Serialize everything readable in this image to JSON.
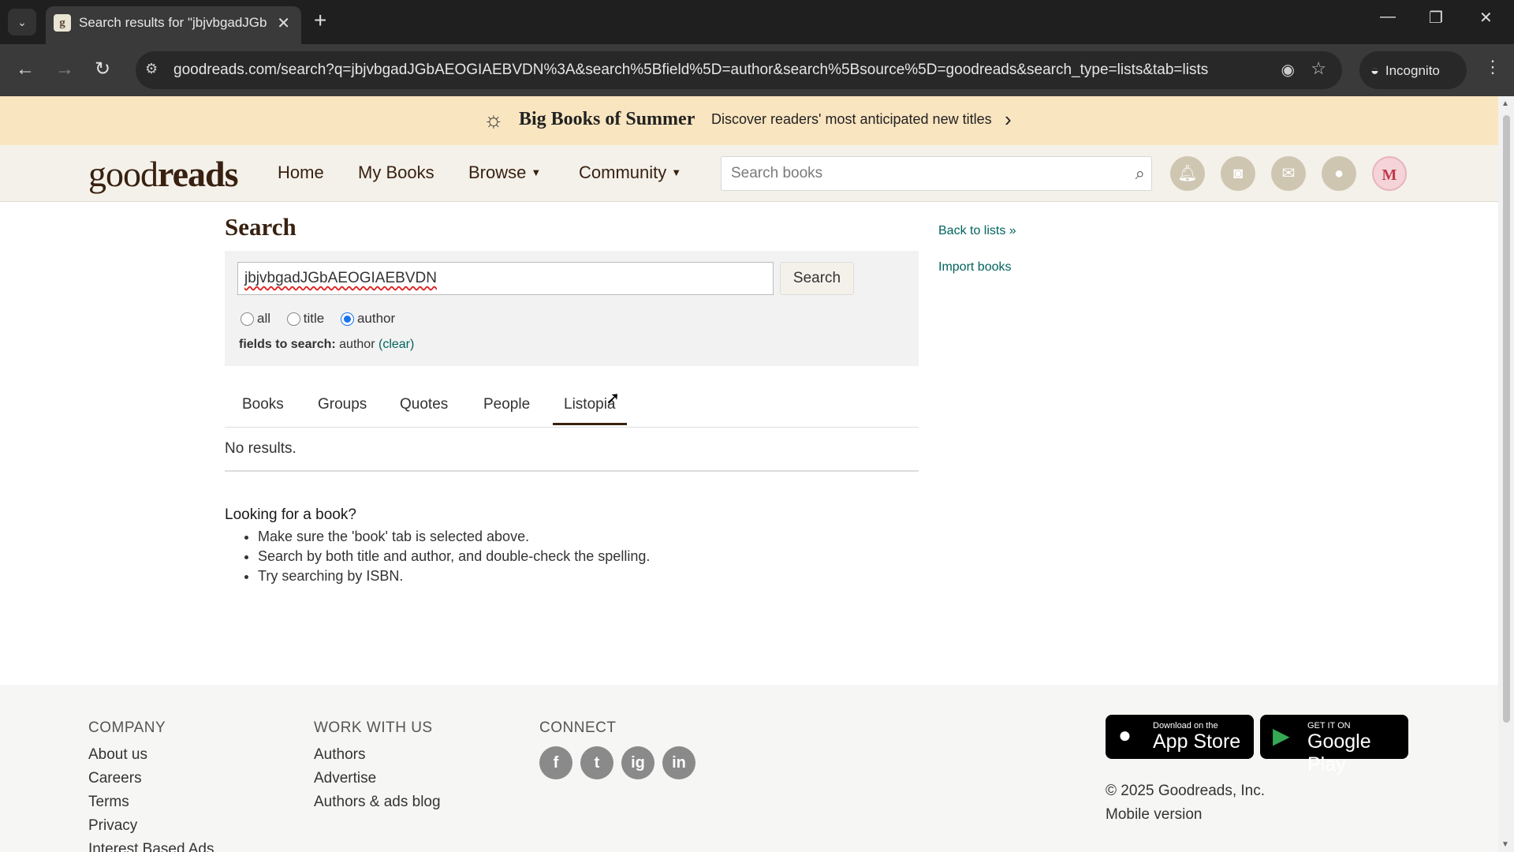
{
  "browser": {
    "tab_title": "Search results for \"jbjvbgadJGb",
    "tab_close": "✕",
    "new_tab": "+",
    "url": "goodreads.com/search?q=jbjvbgadJGbAEOGIAEBVDN%3A&search%5Bfield%5D=author&search%5Bsource%5D=goodreads&search_type=lists&tab=lists",
    "incognito_label": "Incognito"
  },
  "banner": {
    "title": "Big Books of Summer",
    "subtitle": "Discover readers' most anticipated new titles"
  },
  "header": {
    "logo_light": "good",
    "logo_bold": "reads",
    "nav": {
      "home": "Home",
      "my_books": "My Books",
      "browse": "Browse",
      "community": "Community"
    },
    "search_placeholder": "Search books",
    "avatar_initial": "M"
  },
  "search": {
    "heading": "Search",
    "query": "jbjvbgadJGbAEOGIAEBVDN",
    "button": "Search",
    "radio_all": "all",
    "radio_title": "title",
    "radio_author": "author",
    "selected": "author",
    "fields_label": "fields to search:",
    "fields_value": "author",
    "clear_label": "(clear)"
  },
  "tabs": {
    "books": "Books",
    "groups": "Groups",
    "quotes": "Quotes",
    "people": "People",
    "lists": "Listopia",
    "active": "lists"
  },
  "results": {
    "no_results": "No results.",
    "tips_heading": "Looking for a book?",
    "tips": [
      "Make sure the 'book' tab is selected above.",
      "Search by both title and author, and double-check the spelling.",
      "Try searching by ISBN."
    ]
  },
  "sidebar": {
    "back_to_lists": "Back to lists »",
    "import_books": "Import books"
  },
  "footer": {
    "company_heading": "COMPANY",
    "company_links": [
      "About us",
      "Careers",
      "Terms",
      "Privacy",
      "Interest Based Ads"
    ],
    "work_heading": "WORK WITH US",
    "work_links": [
      "Authors",
      "Advertise",
      "Authors & ads blog"
    ],
    "connect_heading": "CONNECT",
    "social": [
      "f",
      "t",
      "ig",
      "in"
    ],
    "app_store_small": "Download on the",
    "app_store_large": "App Store",
    "google_small": "GET IT ON",
    "google_large": "Google Play",
    "copyright": "© 2025 Goodreads, Inc.",
    "mobile_version": "Mobile version"
  },
  "colors": {
    "brand_brown": "#382110",
    "link_green": "#00635d",
    "banner_bg": "#f9e5c0",
    "header_bg": "#f4f1ea"
  }
}
